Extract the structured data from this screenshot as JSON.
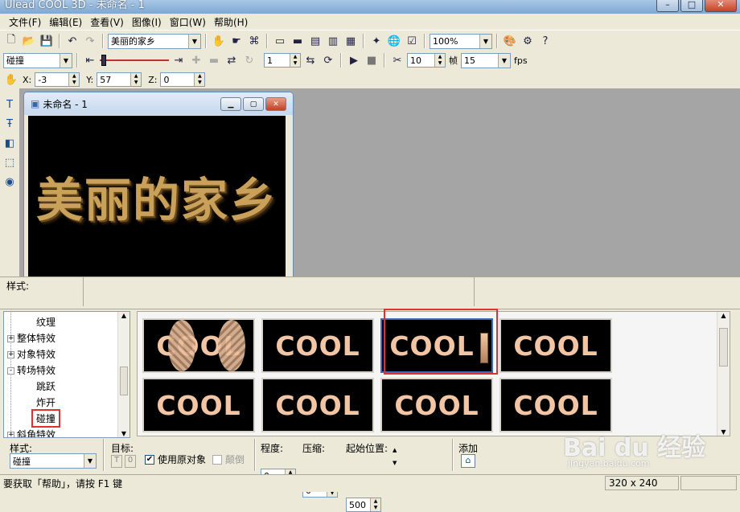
{
  "app": {
    "title": "Ulead COOL 3D - 未命名 - 1"
  },
  "menu": [
    "文件(F)",
    "编辑(E)",
    "查看(V)",
    "图像(I)",
    "窗口(W)",
    "帮助(H)"
  ],
  "toolbar1": {
    "text_object": "美丽的家乡",
    "zoom": "100%"
  },
  "toolbar2": {
    "effect_combo": "碰撞",
    "frame": "1",
    "frame_count": "10",
    "frame_label": "帧",
    "fps_value": "15",
    "fps_label": "fps"
  },
  "toolbar3": {
    "x_label": "X:",
    "x_value": "-3",
    "y_label": "Y:",
    "y_value": "57",
    "z_label": "Z:",
    "z_value": "0"
  },
  "document": {
    "title": "未命名 - 1",
    "canvas_text": "美丽的家乡"
  },
  "style_bar": {
    "label": "样式:"
  },
  "tree": {
    "items": [
      {
        "label": "纹理",
        "type": "child"
      },
      {
        "label": "整体特效",
        "type": "folder",
        "expander": "+"
      },
      {
        "label": "对象特效",
        "type": "folder",
        "expander": "+"
      },
      {
        "label": "转场特效",
        "type": "folder",
        "expander": "-"
      },
      {
        "label": "跳跃",
        "type": "child"
      },
      {
        "label": "炸开",
        "type": "child"
      },
      {
        "label": "碰撞",
        "type": "child",
        "selected": true
      },
      {
        "label": "斜角特效",
        "type": "folder",
        "expander": "+"
      }
    ]
  },
  "gallery": {
    "thumbs": [
      "COOL",
      "COOL",
      "COOL",
      "COOL",
      "COOL",
      "COOL",
      "COOL",
      "COOL"
    ],
    "selected_index": 2
  },
  "options": {
    "style_label": "样式:",
    "style_value": "碰撞",
    "target_label": "目标:",
    "target_t": "T",
    "target_0": "0",
    "use_original_label": "使用原对象",
    "use_original_checked": true,
    "flip_label": "颠倒",
    "flip_checked": false,
    "degree_label": "程度:",
    "degree_value": "0",
    "compress_label": "压缩:",
    "compress_value": "0",
    "start_label": "起始位置:",
    "start_value": "500",
    "add_label": "添加"
  },
  "status": {
    "help_text": "要获取「帮助」，请按 F1 键",
    "size": "320 x 240"
  },
  "watermark": {
    "brand": "Bai du 经验",
    "url": "jingyan.baidu.com"
  },
  "colors": {
    "canvas_bg": "#000000",
    "workarea": "#a5a5a5",
    "highlight_box": "#e03030",
    "thumb_text": "#f2c5a4"
  }
}
